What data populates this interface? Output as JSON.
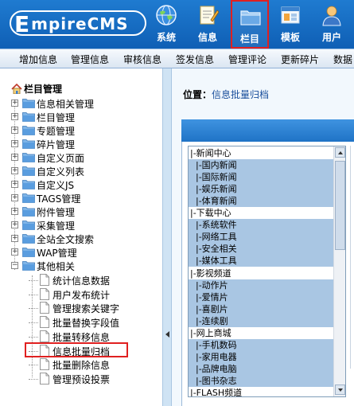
{
  "header": {
    "logo_big": "E",
    "logo_rest": "mpireCMS",
    "nav": [
      {
        "label": "系统",
        "icon": "globe-icon"
      },
      {
        "label": "信息",
        "icon": "document-icon"
      },
      {
        "label": "栏目",
        "icon": "folder-icon",
        "active": true
      },
      {
        "label": "模板",
        "icon": "window-icon"
      },
      {
        "label": "用户",
        "icon": "user-icon"
      }
    ]
  },
  "menubar": [
    "增加信息",
    "管理信息",
    "审核信息",
    "签发信息",
    "管理评论",
    "更新碎片",
    "数据"
  ],
  "left": {
    "title": "栏目管理",
    "tree": [
      "信息相关管理",
      "栏目管理",
      "专题管理",
      "碎片管理",
      "自定义页面",
      "自定义列表",
      "自定义JS",
      "TAGS管理",
      "附件管理",
      "采集管理",
      "全站全文搜索",
      "WAP管理",
      "其他相关"
    ],
    "children": [
      "统计信息数据",
      "用户发布统计",
      "管理搜索关键字",
      "批量替换字段值",
      "批量转移信息",
      "信息批量归档",
      "批量删除信息",
      "管理预设投票"
    ],
    "selected_child": "信息批量归档"
  },
  "main": {
    "location_label": "位置：",
    "location_value": "信息批量归档",
    "list": [
      {
        "text": "|-新闻中心",
        "sel": false
      },
      {
        "text": "  |-国内新闻",
        "sel": true
      },
      {
        "text": "  |-国际新闻",
        "sel": true
      },
      {
        "text": "  |-娱乐新闻",
        "sel": true
      },
      {
        "text": "  |-体育新闻",
        "sel": true
      },
      {
        "text": "|-下载中心",
        "sel": false
      },
      {
        "text": "  |-系统软件",
        "sel": true
      },
      {
        "text": "  |-网络工具",
        "sel": true
      },
      {
        "text": "  |-安全相关",
        "sel": true
      },
      {
        "text": "  |-媒体工具",
        "sel": true
      },
      {
        "text": "|-影视频道",
        "sel": false
      },
      {
        "text": "  |-动作片",
        "sel": true
      },
      {
        "text": "  |-爱情片",
        "sel": true
      },
      {
        "text": "  |-喜剧片",
        "sel": true
      },
      {
        "text": "  |-连续剧",
        "sel": true
      },
      {
        "text": "|-网上商城",
        "sel": false
      },
      {
        "text": "  |-手机数码",
        "sel": true
      },
      {
        "text": "  |-家用电器",
        "sel": true
      },
      {
        "text": "  |-品牌电脑",
        "sel": true
      },
      {
        "text": "  |-图书杂志",
        "sel": true
      },
      {
        "text": "|-FLASH频道",
        "sel": false
      }
    ]
  },
  "colors": {
    "header_blue": "#1670c8",
    "selection": "#a9c6e3",
    "active_border": "#e02020"
  }
}
